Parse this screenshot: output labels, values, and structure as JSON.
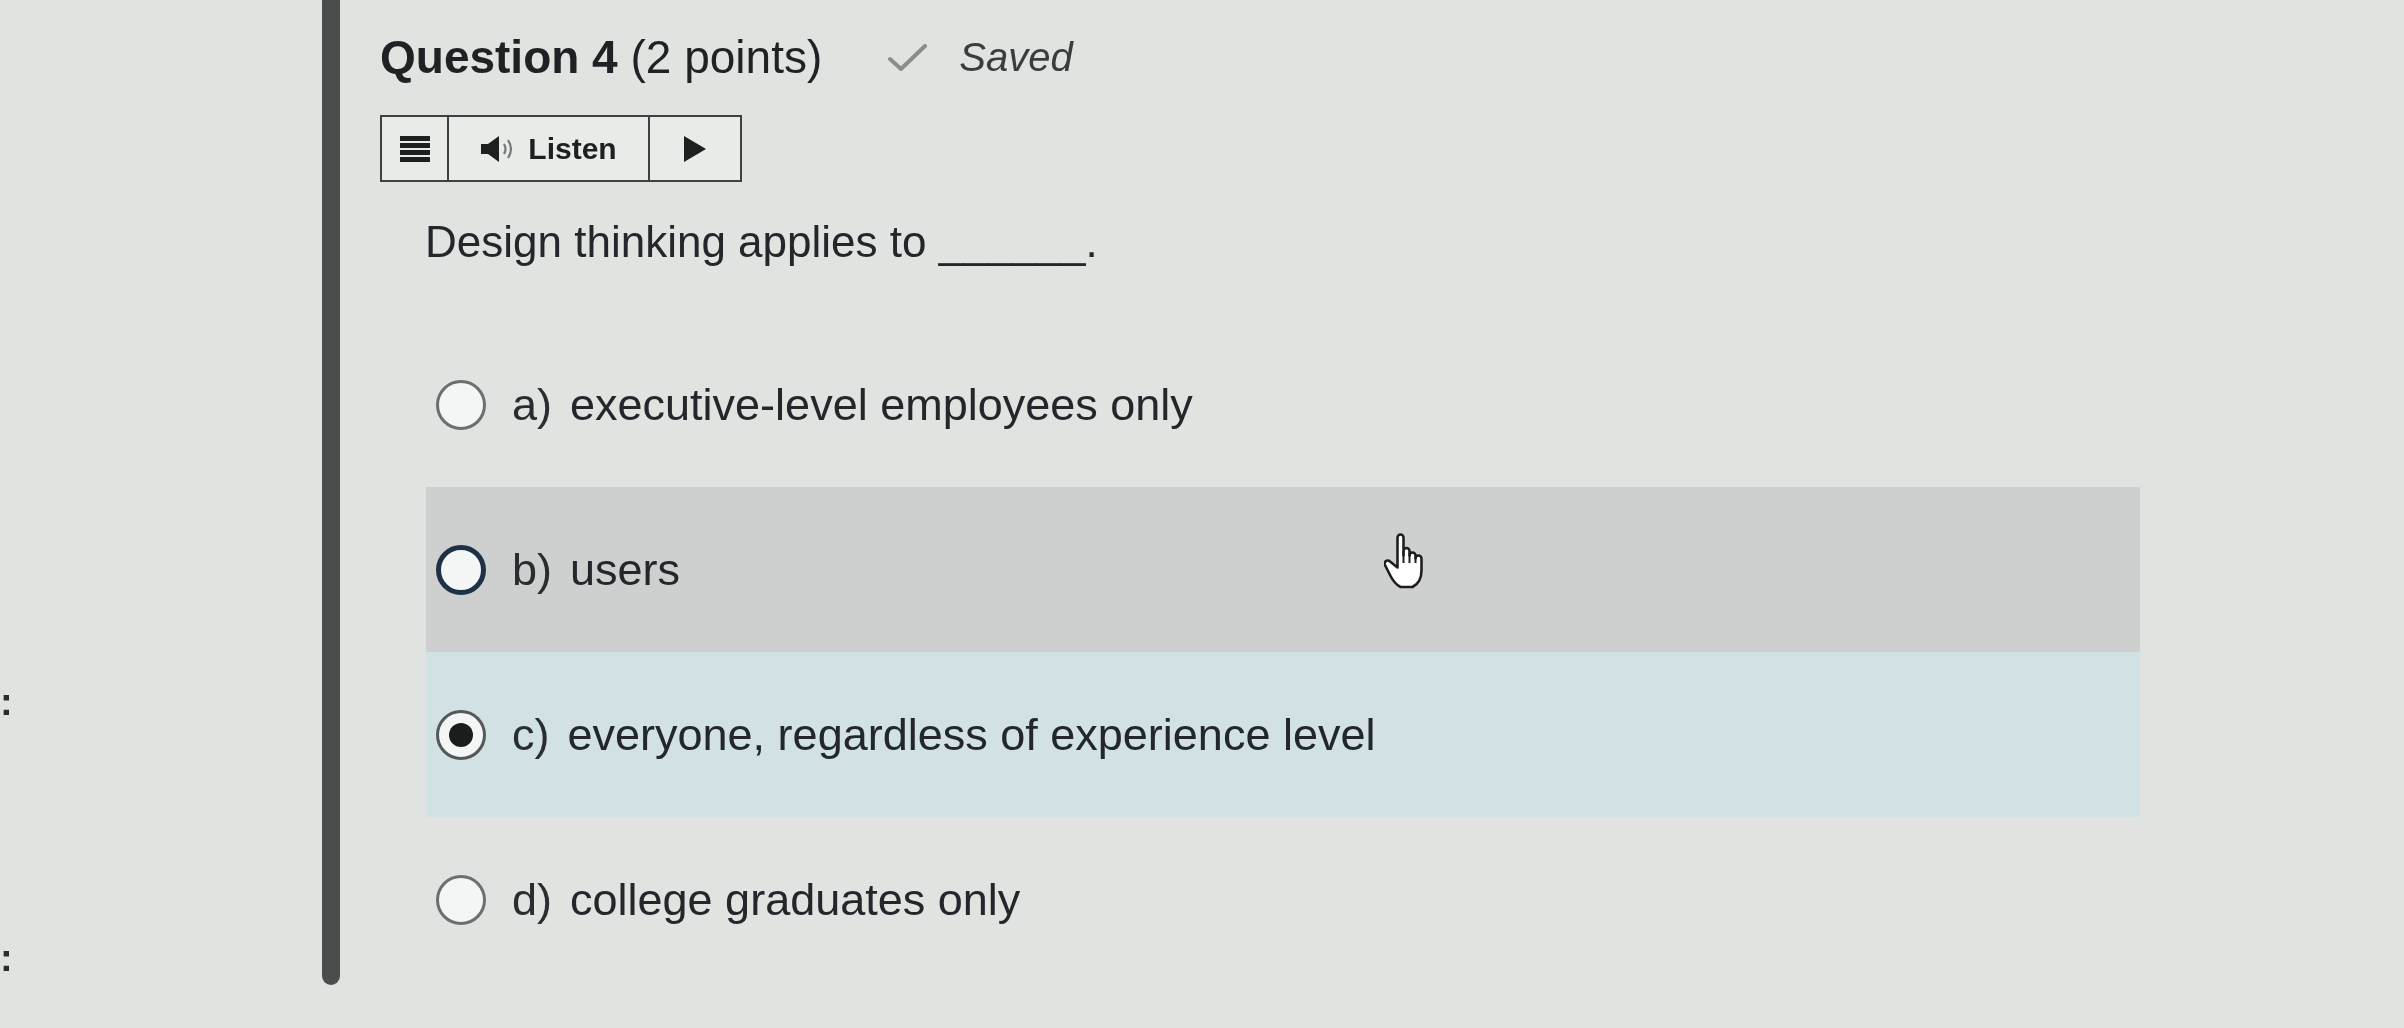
{
  "sidebar_labels": [
    ":",
    ":"
  ],
  "question": {
    "title": "**Question 4** (2 points)",
    "saved": true,
    "save_status": "Saved"
  },
  "listen_toolbar": {
    "label": "Listen"
  },
  "prompt": "Design thinking applies to ______.",
  "options": [
    {
      "letter": "a)",
      "text": "executive-level employees only",
      "selected": false,
      "hovered": false
    },
    {
      "letter": "b)",
      "text": "users",
      "selected": false,
      "hovered": true
    },
    {
      "letter": "c)",
      "text": "everyone, regardless of experience level",
      "selected": true,
      "hovered": false
    },
    {
      "letter": "d)",
      "text": "college graduates only",
      "selected": false,
      "hovered": false
    }
  ]
}
